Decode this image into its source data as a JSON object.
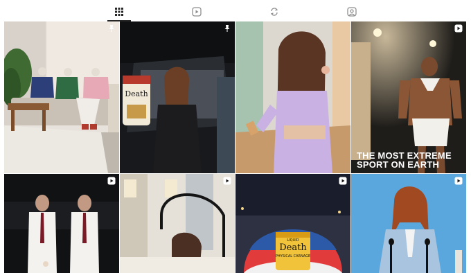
{
  "tabs": [
    {
      "name": "posts",
      "icon": "grid-icon",
      "active": true
    },
    {
      "name": "reels",
      "icon": "reels-icon",
      "active": false
    },
    {
      "name": "reposts",
      "icon": "repost-icon",
      "active": false
    },
    {
      "name": "tagged",
      "icon": "tagged-user-icon",
      "active": false
    }
  ],
  "posts": [
    {
      "badge": "pin-icon",
      "scene": "mannequins seated on couch"
    },
    {
      "badge": "pin-icon",
      "scene": "woman in car holding Death can"
    },
    {
      "badge": "",
      "scene": "woman in lavender outfit holding phone"
    },
    {
      "badge": "reel-icon",
      "scene": "man in diaper costume",
      "overlay": [
        "THE MOST EXTREME",
        "SPORT ON EARTH"
      ]
    },
    {
      "badge": "reel-icon",
      "scene": "two men in shirts and ties"
    },
    {
      "badge": "reel-icon",
      "scene": "woman at faucet"
    },
    {
      "badge": "reel-icon",
      "scene": "giant can on sphere",
      "can_text": [
        "LIQUID",
        "Death",
        "PHYSICAL CARNAGE"
      ]
    },
    {
      "badge": "reel-icon",
      "scene": "woman at podium microphones"
    }
  ],
  "can_label": {
    "top": "LIQUID",
    "brand": "Death",
    "sub": "MOUNTAIN WATER"
  },
  "colors": {
    "active_tab": "#262626",
    "inactive_tab": "#8e8e8e"
  }
}
